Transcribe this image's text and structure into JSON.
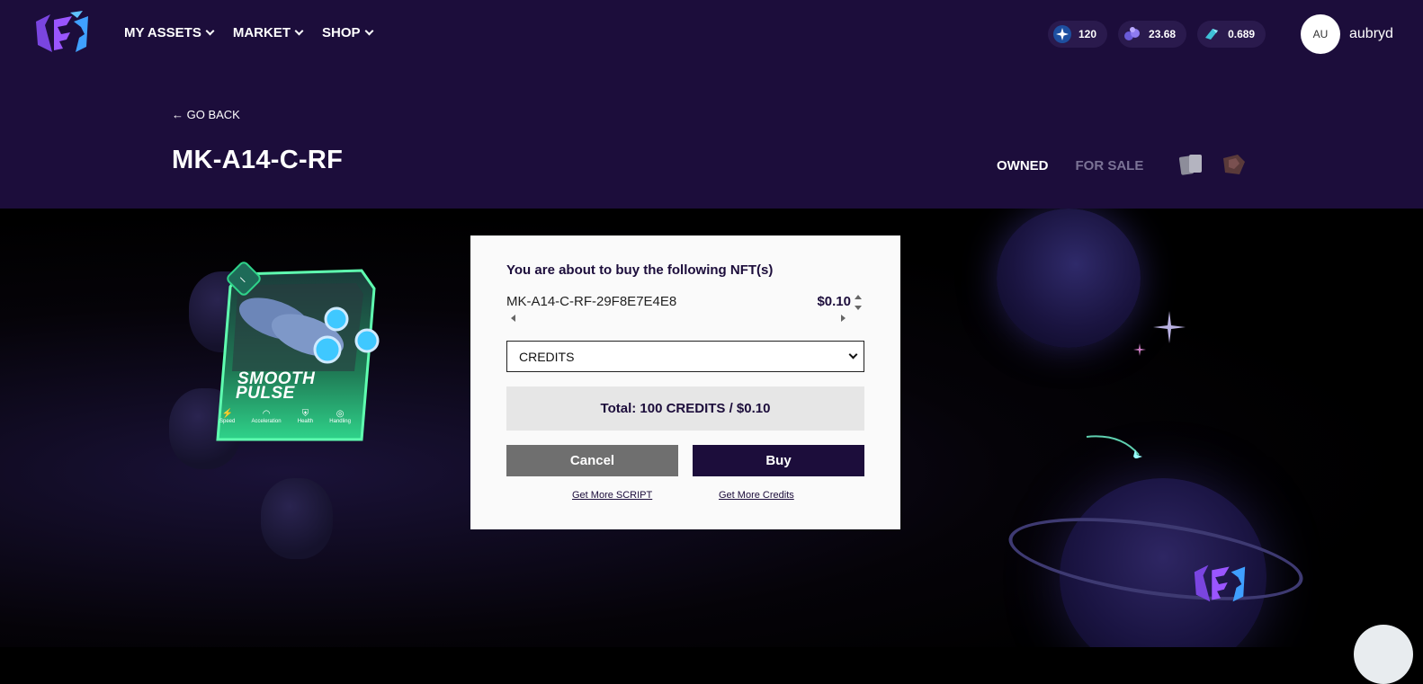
{
  "nav": {
    "items": [
      {
        "label": "MY ASSETS"
      },
      {
        "label": "MARKET"
      },
      {
        "label": "SHOP"
      }
    ]
  },
  "balances": [
    {
      "icon": "star-token-icon",
      "value": "120"
    },
    {
      "icon": "gem-cluster-icon",
      "value": "23.68"
    },
    {
      "icon": "crystal-icon",
      "value": "0.689"
    }
  ],
  "user": {
    "initials": "AU",
    "name": "aubryd"
  },
  "page": {
    "back_label": "← GO BACK",
    "title": "MK-A14-C-RF",
    "tabs": [
      {
        "label": "OWNED",
        "active": true
      },
      {
        "label": "FOR SALE",
        "active": false
      }
    ]
  },
  "card": {
    "badge": "–",
    "name_line1": "SMOOTH",
    "name_line2": "PULSE",
    "stats": [
      "Speed",
      "Acceleration",
      "Health",
      "Handling"
    ]
  },
  "modal": {
    "heading": "You are about to buy the following NFT(s)",
    "nft_id": "MK-A14-C-RF-29F8E7E4E8",
    "price": "$0.10",
    "currency_selected": "CREDITS",
    "total": "Total: 100 CREDITS / $0.10",
    "cancel_label": "Cancel",
    "buy_label": "Buy",
    "link_script": "Get More SCRIPT",
    "link_credits": "Get More Credits"
  },
  "colors": {
    "header_bg": "#1c0d3b",
    "accent_purple": "#8a4dff",
    "card_green": "#2fd38a",
    "buy_button": "#1c0d3b",
    "cancel_button": "#6f6f6f"
  }
}
